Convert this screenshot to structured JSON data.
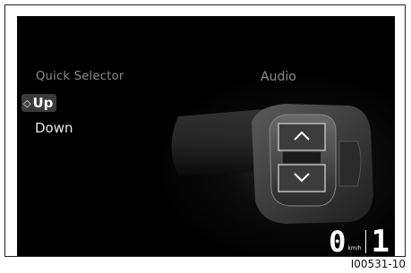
{
  "menu": {
    "title": "Quick Selector",
    "selected_marker": "◇",
    "items": [
      {
        "label": "Up",
        "selected": true
      },
      {
        "label": "Down",
        "selected": false
      }
    ]
  },
  "panel": {
    "title": "Audio"
  },
  "status": {
    "speed": "0",
    "speed_unit": "km/h",
    "assist_level": "1"
  },
  "figure_id": "I00531-10",
  "colors": {
    "screen_bg": "#000000",
    "menu_text": "#8a8a8a",
    "selected_bg": "#3a3a3a",
    "text": "#ffffff"
  }
}
